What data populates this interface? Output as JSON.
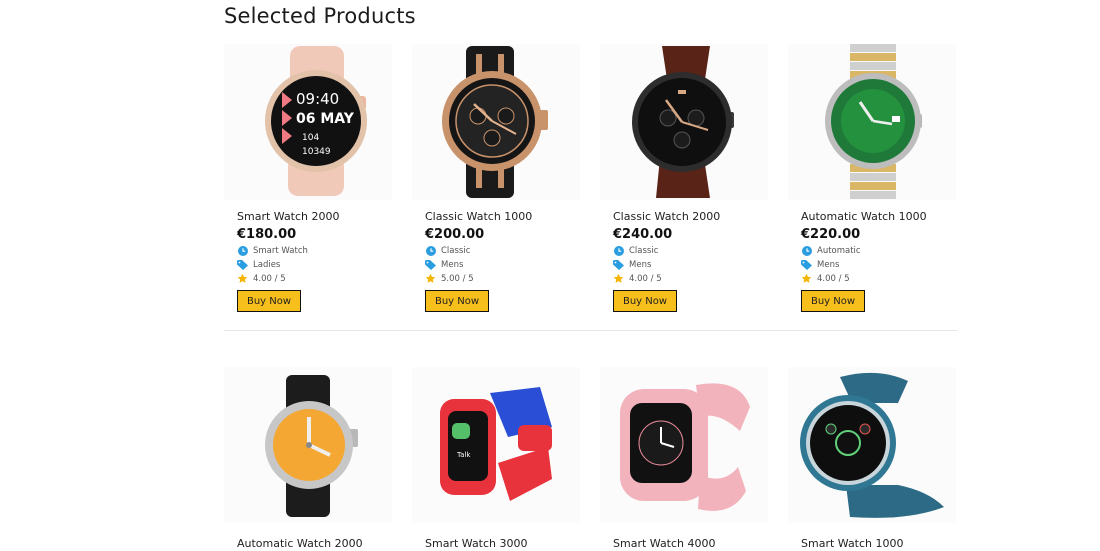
{
  "section": {
    "title": "Selected Products"
  },
  "colors": {
    "accent": "#f7bf1c",
    "category_icon": "#2a9de0",
    "tag_icon": "#2a9de0",
    "star": "#f5b400"
  },
  "products": [
    {
      "name": "Smart Watch 2000",
      "price": "€180.00",
      "category": "Smart Watch",
      "gender": "Ladies",
      "rating": "4.00 / 5",
      "button": "Buy Now",
      "image": "rose-smart-watch-image",
      "face_text": [
        "09:40",
        "06 MAY",
        "104",
        "10349"
      ]
    },
    {
      "name": "Classic Watch 1000",
      "price": "€200.00",
      "category": "Classic",
      "gender": "Mens",
      "rating": "5.00 / 5",
      "button": "Buy Now",
      "image": "gold-chronograph-watch-image"
    },
    {
      "name": "Classic Watch 2000",
      "price": "€240.00",
      "category": "Classic",
      "gender": "Mens",
      "rating": "4.00 / 5",
      "button": "Buy Now",
      "image": "brown-leather-chronograph-image"
    },
    {
      "name": "Automatic Watch 1000",
      "price": "€220.00",
      "category": "Automatic",
      "gender": "Mens",
      "rating": "4.00 / 5",
      "button": "Buy Now",
      "image": "green-dial-steel-watch-image"
    },
    {
      "name": "Automatic Watch 2000",
      "image": "orange-dial-diver-watch-image"
    },
    {
      "name": "Smart Watch 3000",
      "image": "kids-red-smart-watch-image",
      "face_text": [
        "Talk"
      ]
    },
    {
      "name": "Smart Watch 4000",
      "image": "pink-kids-smart-watch-image"
    },
    {
      "name": "Smart Watch 1000",
      "image": "blue-round-smart-watch-image"
    }
  ]
}
